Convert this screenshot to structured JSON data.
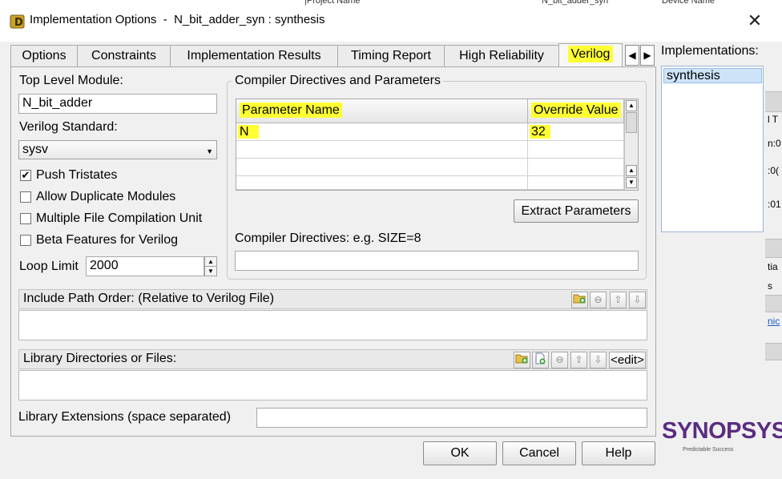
{
  "window": {
    "title": "Implementation Options  -  N_bit_adder_syn : synthesis",
    "bg_project_name": "|Project Name",
    "bg_project_value": "N_bit_adder_syn",
    "bg_device_name": "Device Name"
  },
  "tabs": [
    {
      "label": "Options"
    },
    {
      "label": "Constraints"
    },
    {
      "label": "Implementation Results"
    },
    {
      "label": "Timing Report"
    },
    {
      "label": "High Reliability"
    },
    {
      "label": "Verilog"
    }
  ],
  "left": {
    "top_level_module_label": "Top Level Module:",
    "top_level_module_value": "N_bit_adder",
    "verilog_standard_label": "Verilog Standard:",
    "verilog_standard_value": "sysv",
    "checkboxes": [
      {
        "label": "Push Tristates",
        "checked": true
      },
      {
        "label": "Allow Duplicate Modules",
        "checked": false
      },
      {
        "label": "Multiple File Compilation Unit",
        "checked": false
      },
      {
        "label": "Beta Features for Verilog",
        "checked": false
      }
    ],
    "loop_limit_label": "Loop Limit",
    "loop_limit_value": "2000"
  },
  "compiler": {
    "group_title": "Compiler Directives and Parameters",
    "col_param": "Parameter Name",
    "col_override": "Override Value",
    "rows": [
      {
        "name": "N",
        "value": "32"
      },
      {
        "name": "",
        "value": ""
      },
      {
        "name": "",
        "value": ""
      },
      {
        "name": "",
        "value": ""
      }
    ],
    "extract_button": "Extract Parameters",
    "directives_label": "Compiler Directives: e.g. SIZE=8",
    "directives_value": ""
  },
  "include_path": {
    "label": "Include Path Order: (Relative to Verilog File)"
  },
  "library": {
    "label": "Library Directories or Files:",
    "edit_button": "<edit>",
    "extensions_label": "Library Extensions (space separated)",
    "extensions_value": ""
  },
  "implementations": {
    "label": "Implementations:",
    "items": [
      "synthesis"
    ]
  },
  "buttons": {
    "ok": "OK",
    "cancel": "Cancel",
    "help": "Help"
  },
  "logo": {
    "name": "SYNOPSYS",
    "tagline": "Predictable Success"
  },
  "peek": {
    "p1": "l T",
    "p2": "n:0",
    "p3": ":0(",
    "p4": ":01",
    "p5": "tia",
    "p6": "s",
    "p7": "nic"
  },
  "colors": {
    "highlight": "#ffff33",
    "selection": "#cde3f8",
    "logo": "#5a2d82"
  }
}
